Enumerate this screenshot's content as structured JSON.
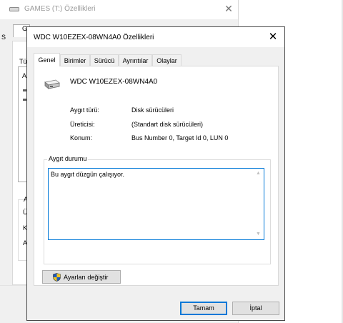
{
  "background_window": {
    "title": "GAMES (T:) Özellikleri",
    "close_glyph": "✕",
    "fragments": [
      "G",
      "S",
      "Tü",
      "A",
      "A",
      "Ü",
      "K",
      "A"
    ]
  },
  "dialog": {
    "title": "WDC W10EZEX-08WN4A0 Özellikleri",
    "close_glyph": "✕",
    "tabs": [
      {
        "label": "Genel",
        "active": true
      },
      {
        "label": "Birimler"
      },
      {
        "label": "Sürücü"
      },
      {
        "label": "Ayrıntılar"
      },
      {
        "label": "Olaylar"
      }
    ],
    "device_name": "WDC W10EZEX-08WN4A0",
    "properties": [
      {
        "label": "Aygıt türü:",
        "value": "Disk sürücüleri"
      },
      {
        "label": "Üreticisi:",
        "value": "(Standart disk sürücüleri)"
      },
      {
        "label": "Konum:",
        "value": "Bus Number 0, Target Id 0, LUN 0"
      }
    ],
    "status_group_label": "Aygıt durumu",
    "status_text": "Bu aygıt düzgün çalışıyor.",
    "change_settings_label": "Ayarları değiştir",
    "ok_label": "Tamam",
    "cancel_label": "İptal"
  },
  "colors": {
    "accent": "#0078d7",
    "window_bg": "#f0f0f0"
  },
  "icons": [
    "hard-drive-icon",
    "shield-icon",
    "close-icon",
    "scroll-up-icon",
    "scroll-down-icon"
  ]
}
